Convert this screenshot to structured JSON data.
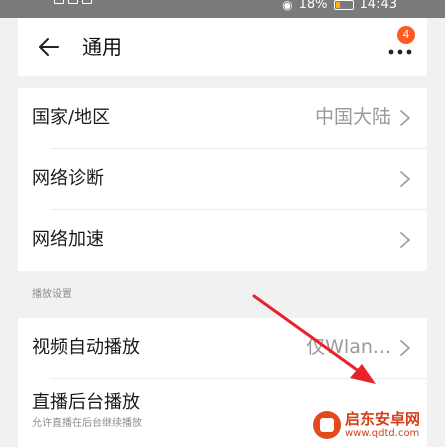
{
  "status_bar": {
    "battery": "18%",
    "time": "14:43",
    "battery_color": "#ffb400"
  },
  "header": {
    "title": "通用",
    "back_icon": "arrow-left-icon",
    "more_icon": "more-dots-icon",
    "badge_count": "4",
    "badge_color": "#ff5a22"
  },
  "settings": {
    "items": [
      {
        "label": "国家/地区",
        "value": "中国大陆"
      },
      {
        "label": "网络诊断",
        "value": ""
      },
      {
        "label": "网络加速",
        "value": ""
      }
    ]
  },
  "playback": {
    "section_title": "播放设置",
    "items": [
      {
        "label": "视频自动播放",
        "value": "仅Wlan..."
      },
      {
        "label": "直播后台播放",
        "sublabel": "允许直播在后台继续播放"
      }
    ]
  },
  "annotation": {
    "arrow_color": "#e8222a"
  },
  "watermark": {
    "title": "启东安卓网",
    "url": "www.qdtd.com"
  }
}
